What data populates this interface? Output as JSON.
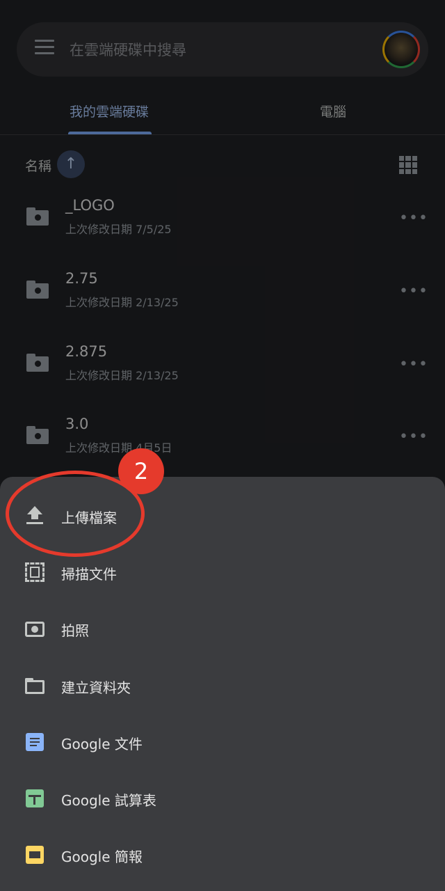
{
  "search": {
    "placeholder": "在雲端硬碟中搜尋"
  },
  "tabs": [
    {
      "label": "我的雲端硬碟",
      "active": true
    },
    {
      "label": "電腦",
      "active": false
    }
  ],
  "sort": {
    "label": "名稱",
    "direction_icon": "arrow-up-icon"
  },
  "files": [
    {
      "name": "_LOGO",
      "meta": "上次修改日期 7/5/25"
    },
    {
      "name": "2.75",
      "meta": "上次修改日期 2/13/25"
    },
    {
      "name": "2.875",
      "meta": "上次修改日期 2/13/25"
    },
    {
      "name": "3.0",
      "meta": "上次修改日期 4月5日"
    }
  ],
  "sheet": {
    "items": [
      {
        "label": "上傳檔案",
        "icon": "upload-icon"
      },
      {
        "label": "掃描文件",
        "icon": "scan-icon"
      },
      {
        "label": "拍照",
        "icon": "camera-icon"
      },
      {
        "label": "建立資料夾",
        "icon": "folder-icon"
      },
      {
        "label": "Google 文件",
        "icon": "google-docs-icon"
      },
      {
        "label": "Google 試算表",
        "icon": "google-sheets-icon"
      },
      {
        "label": "Google 簡報",
        "icon": "google-slides-icon"
      }
    ]
  },
  "annotation": {
    "step": "2"
  },
  "colors": {
    "accent": "#a8c7fa",
    "annotation": "#e53a2c",
    "sheet_bg": "#3b3c3f"
  }
}
